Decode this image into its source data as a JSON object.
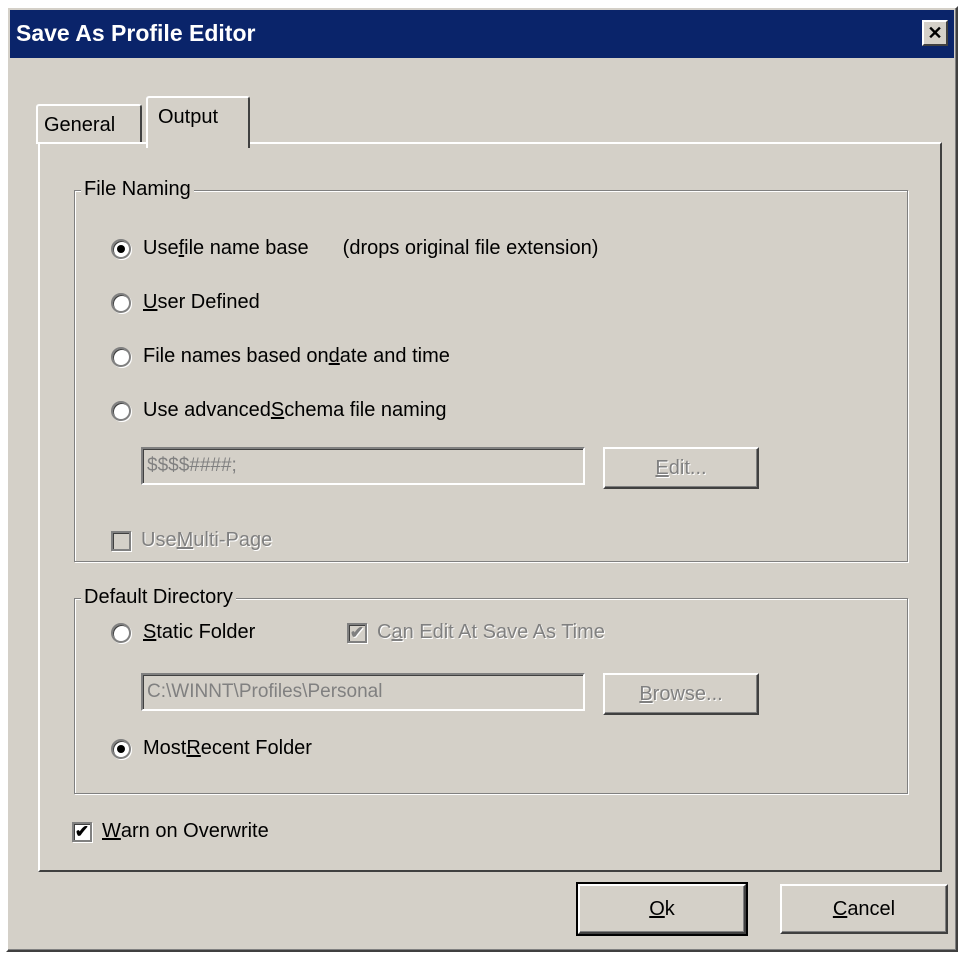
{
  "window": {
    "title": "Save As Profile Editor",
    "close_glyph": "✕"
  },
  "tabs": [
    {
      "label": "General",
      "selected": false
    },
    {
      "label": "Output",
      "selected": true
    }
  ],
  "file_naming": {
    "legend": "File Naming",
    "options": [
      {
        "pre": "Use ",
        "mnemonic": "f",
        "post": "ile name base",
        "note": "(drops original file extension)",
        "selected": true
      },
      {
        "pre": "",
        "mnemonic": "U",
        "post": "ser Defined",
        "selected": false
      },
      {
        "pre": "File names based on ",
        "mnemonic": "d",
        "post": "ate and time",
        "selected": false
      },
      {
        "pre": "Use advanced ",
        "mnemonic": "S",
        "post": "chema file naming",
        "selected": false
      }
    ],
    "schema_value": "$$$$####;",
    "edit_button": {
      "mnemonic": "E",
      "post": "dit..."
    },
    "multipage": {
      "pre": "Use ",
      "mnemonic": "M",
      "post": "ulti-Page",
      "checked": false
    }
  },
  "default_directory": {
    "legend": "Default Directory",
    "static_folder": {
      "pre": "",
      "mnemonic": "S",
      "post": "tatic Folder",
      "selected": false
    },
    "can_edit": {
      "pre": "C",
      "mnemonic": "a",
      "post": "n Edit At Save As Time",
      "checked": true
    },
    "path_value": "C:\\WINNT\\Profiles\\Personal",
    "browse_button": {
      "mnemonic": "B",
      "post": "rowse..."
    },
    "most_recent": {
      "pre": "Most ",
      "mnemonic": "R",
      "post": "ecent Folder",
      "selected": true
    }
  },
  "warn_overwrite": {
    "pre": "",
    "mnemonic": "W",
    "post": "arn on Overwrite",
    "checked": true
  },
  "buttons": {
    "ok": {
      "mnemonic": "O",
      "post": "k"
    },
    "cancel": {
      "mnemonic": "C",
      "post": "ancel"
    }
  },
  "check_glyph": "✔"
}
